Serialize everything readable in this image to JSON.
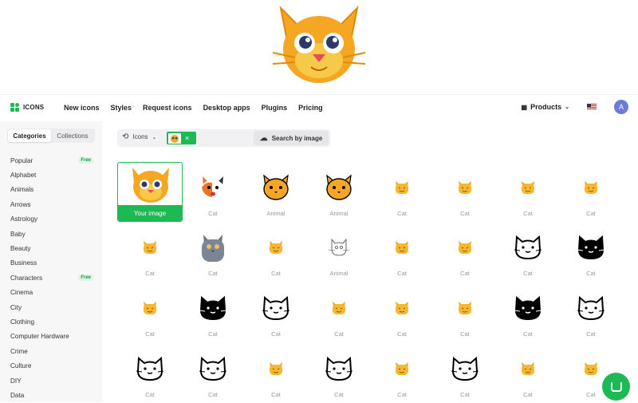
{
  "hero": {
    "image_desc": "cat"
  },
  "brand": {
    "name": "ICONS"
  },
  "nav": {
    "links": [
      "New icons",
      "Styles",
      "Request icons",
      "Desktop apps",
      "Plugins",
      "Pricing"
    ],
    "products_label": "Products",
    "avatar_letter": "A"
  },
  "sidebar": {
    "tabs": [
      "Categories",
      "Collections"
    ],
    "free_label": "Free",
    "categories": [
      "Popular",
      "Alphabet",
      "Animals",
      "Arrows",
      "Astrology",
      "Baby",
      "Beauty",
      "Business",
      "Characters",
      "Cinema",
      "City",
      "Clothing",
      "Computer Hardware",
      "Crime",
      "Culture",
      "DIY",
      "Data"
    ]
  },
  "search": {
    "type_label": "Icons",
    "button_label": "Search by image"
  },
  "your_image_label": "Your image",
  "results": {
    "row1": [
      "Cat",
      "Animal",
      "Animal",
      "Cat",
      "Cat",
      "Cat",
      "Cat"
    ],
    "row2": [
      "Cat",
      "Cat",
      "Cat",
      "Animal",
      "Cat",
      "Cat",
      "Cat",
      "Cat"
    ],
    "row3": [
      "Cat",
      "Cat",
      "Cat",
      "Cat",
      "Cat",
      "Cat",
      "Cat",
      "Cat"
    ],
    "row4": [
      "Cat",
      "Cat",
      "Cat",
      "Cat",
      "Cat",
      "Cat",
      "Cat",
      "Cat"
    ]
  },
  "colors": {
    "accent": "#1db954",
    "cat_orange": "#f5a623",
    "cat_yellow": "#f7c948"
  }
}
